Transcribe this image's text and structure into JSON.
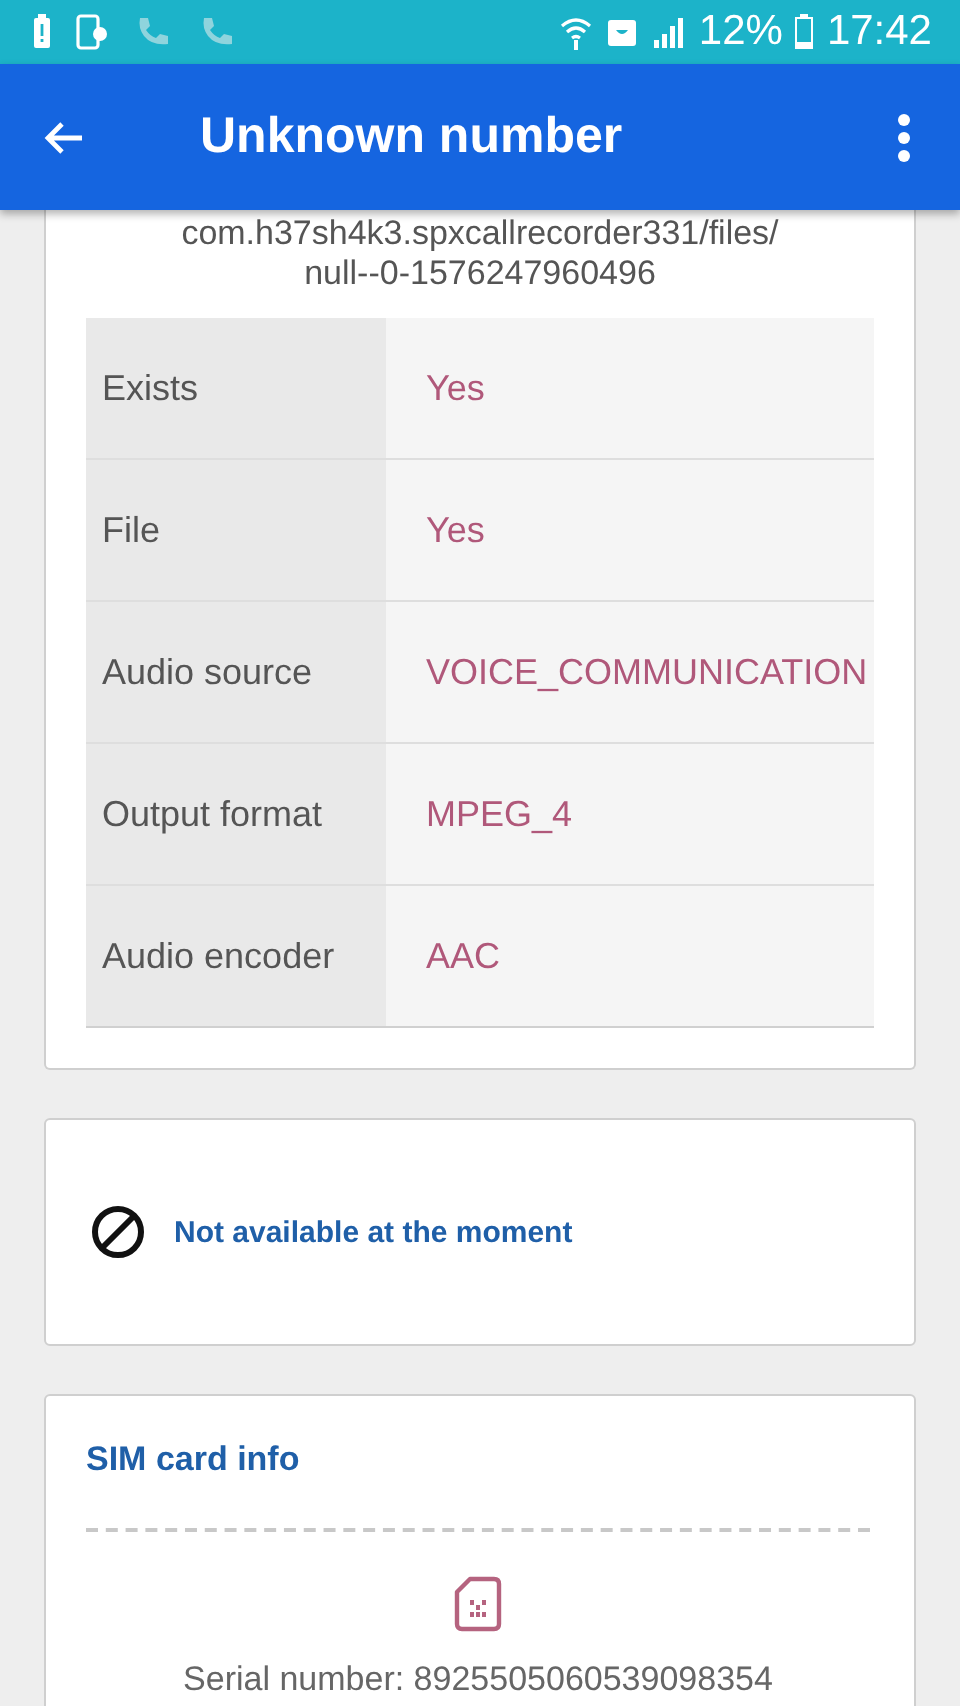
{
  "status_bar": {
    "battery_text": "12%",
    "time": "17:42"
  },
  "app_bar": {
    "title": "Unknown number"
  },
  "file_path": [
    "com.h37sh4k3.spxcallrecorder331/files/",
    "null--0-1576247960496"
  ],
  "details": [
    {
      "label": "Exists",
      "value": "Yes"
    },
    {
      "label": "File",
      "value": "Yes"
    },
    {
      "label": "Audio source",
      "value": "VOICE_COMMUNICATION"
    },
    {
      "label": "Output format",
      "value": "MPEG_4"
    },
    {
      "label": "Audio encoder",
      "value": "AAC"
    }
  ],
  "availability": {
    "message": "Not available at the moment"
  },
  "sim_card": {
    "title": "SIM card info",
    "serial": "Serial number: 8925505060539098354"
  }
}
